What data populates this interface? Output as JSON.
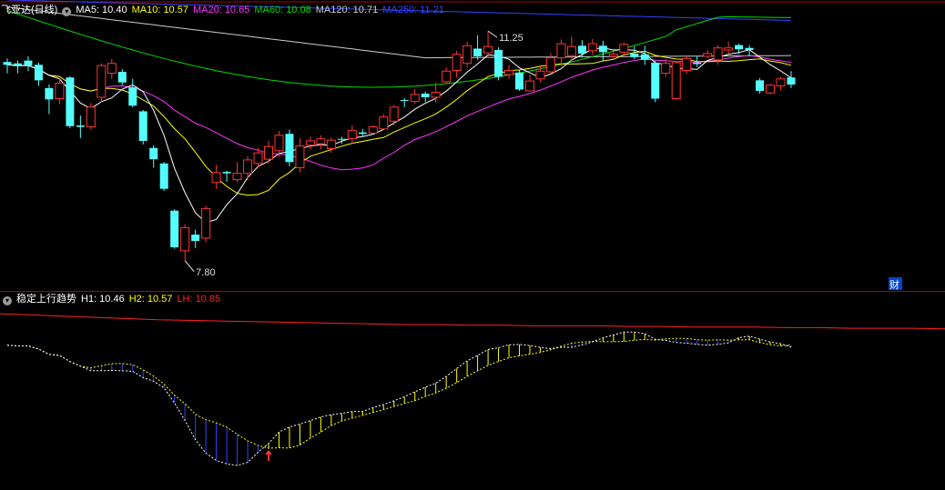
{
  "main_panel": {
    "stock_title": "飞亚达(日线)",
    "indicators": [
      {
        "label": "MA5: 10.40",
        "color": "#ffffff"
      },
      {
        "label": "MA10: 10.57",
        "color": "#ffff00"
      },
      {
        "label": "MA20: 10.65",
        "color": "#ff33ff"
      },
      {
        "label": "MA60: 10.08",
        "color": "#00dd00"
      },
      {
        "label": "MA120: 10.71",
        "color": "#cccccc"
      },
      {
        "label": "MA250: 11.21",
        "color": "#3344ff"
      }
    ],
    "annotations": {
      "high": "11.25",
      "low": "7.80",
      "badge": "财"
    }
  },
  "sub_panel": {
    "title": "稳定上行趋势",
    "indicators": [
      {
        "label": "H1: 10.46",
        "color": "#ffffff"
      },
      {
        "label": "H2: 10.57",
        "color": "#ffff00"
      },
      {
        "label": "LH: 10.85",
        "color": "#ff2222"
      }
    ]
  },
  "colors": {
    "up": "#ff3333",
    "down": "#54ffff",
    "border": "#b00000"
  },
  "chart_data": [
    {
      "type": "candlestick",
      "title": "飞亚达(日线)",
      "ylim": [
        7.5,
        11.5
      ],
      "high_label": 11.25,
      "low_label": 7.8,
      "series": [
        {
          "name": "K",
          "values": [
            {
              "o": 10.62,
              "c": 10.58,
              "h": 10.67,
              "l": 10.46
            },
            {
              "o": 10.6,
              "c": 10.56,
              "h": 10.64,
              "l": 10.46
            },
            {
              "o": 10.64,
              "c": 10.57,
              "h": 10.7,
              "l": 10.49
            },
            {
              "o": 10.58,
              "c": 10.36,
              "h": 10.61,
              "l": 10.28
            },
            {
              "o": 10.25,
              "c": 10.09,
              "h": 10.3,
              "l": 9.88
            },
            {
              "o": 10.1,
              "c": 10.32,
              "h": 10.38,
              "l": 10.02
            },
            {
              "o": 10.4,
              "c": 9.71,
              "h": 10.42,
              "l": 9.68
            },
            {
              "o": 9.72,
              "c": 9.7,
              "h": 9.86,
              "l": 9.54
            },
            {
              "o": 9.7,
              "c": 9.98,
              "h": 10.04,
              "l": 9.66
            },
            {
              "o": 10.12,
              "c": 10.57,
              "h": 10.6,
              "l": 10.05
            },
            {
              "o": 10.46,
              "c": 10.6,
              "h": 10.66,
              "l": 10.38
            },
            {
              "o": 10.48,
              "c": 10.33,
              "h": 10.52,
              "l": 10.29
            },
            {
              "o": 10.26,
              "c": 10.0,
              "h": 10.38,
              "l": 9.98
            },
            {
              "o": 9.92,
              "c": 9.5,
              "h": 9.94,
              "l": 9.45
            },
            {
              "o": 9.4,
              "c": 9.24,
              "h": 9.44,
              "l": 9.12
            },
            {
              "o": 9.18,
              "c": 8.82,
              "h": 9.2,
              "l": 8.79
            },
            {
              "o": 8.51,
              "c": 7.99,
              "h": 8.53,
              "l": 7.97
            },
            {
              "o": 7.94,
              "c": 8.27,
              "h": 8.32,
              "l": 7.8
            },
            {
              "o": 8.17,
              "c": 8.08,
              "h": 8.24,
              "l": 7.98
            },
            {
              "o": 8.12,
              "c": 8.54,
              "h": 8.58,
              "l": 8.06
            },
            {
              "o": 8.91,
              "c": 9.05,
              "h": 9.16,
              "l": 8.82
            },
            {
              "o": 9.06,
              "c": 9.04,
              "h": 9.08,
              "l": 8.92
            },
            {
              "o": 8.95,
              "c": 9.04,
              "h": 9.2,
              "l": 8.91
            },
            {
              "o": 9.04,
              "c": 9.23,
              "h": 9.28,
              "l": 8.94
            },
            {
              "o": 9.18,
              "c": 9.33,
              "h": 9.4,
              "l": 9.12
            },
            {
              "o": 9.24,
              "c": 9.42,
              "h": 9.5,
              "l": 9.18
            },
            {
              "o": 9.36,
              "c": 9.58,
              "h": 9.64,
              "l": 9.27
            },
            {
              "o": 9.6,
              "c": 9.2,
              "h": 9.66,
              "l": 9.14
            },
            {
              "o": 9.12,
              "c": 9.43,
              "h": 9.54,
              "l": 9.05
            },
            {
              "o": 9.44,
              "c": 9.5,
              "h": 9.56,
              "l": 9.38
            },
            {
              "o": 9.46,
              "c": 9.53,
              "h": 9.58,
              "l": 9.38
            },
            {
              "o": 9.39,
              "c": 9.51,
              "h": 9.55,
              "l": 9.33
            },
            {
              "o": 9.53,
              "c": 9.52,
              "h": 9.56,
              "l": 9.46
            },
            {
              "o": 9.53,
              "c": 9.65,
              "h": 9.72,
              "l": 9.46
            },
            {
              "o": 9.62,
              "c": 9.6,
              "h": 9.67,
              "l": 9.56
            },
            {
              "o": 9.61,
              "c": 9.7,
              "h": 9.72,
              "l": 9.6
            },
            {
              "o": 9.67,
              "c": 9.84,
              "h": 9.88,
              "l": 9.66
            },
            {
              "o": 9.78,
              "c": 9.98,
              "h": 10.01,
              "l": 9.72
            },
            {
              "o": 10.08,
              "c": 10.07,
              "h": 10.11,
              "l": 9.98
            },
            {
              "o": 10.06,
              "c": 10.16,
              "h": 10.24,
              "l": 10.03
            },
            {
              "o": 10.17,
              "c": 10.12,
              "h": 10.2,
              "l": 10.05
            },
            {
              "o": 10.12,
              "c": 10.19,
              "h": 10.33,
              "l": 10.05
            },
            {
              "o": 10.34,
              "c": 10.49,
              "h": 10.54,
              "l": 10.32
            },
            {
              "o": 10.5,
              "c": 10.73,
              "h": 10.78,
              "l": 10.4
            },
            {
              "o": 10.6,
              "c": 10.85,
              "h": 10.91,
              "l": 10.55
            },
            {
              "o": 10.81,
              "c": 10.7,
              "h": 11.0,
              "l": 10.65
            },
            {
              "o": 10.75,
              "c": 10.84,
              "h": 11.06,
              "l": 10.7
            },
            {
              "o": 10.79,
              "c": 10.41,
              "h": 10.83,
              "l": 10.36
            },
            {
              "o": 10.44,
              "c": 10.5,
              "h": 10.58,
              "l": 10.38
            },
            {
              "o": 10.47,
              "c": 10.23,
              "h": 10.5,
              "l": 10.21
            },
            {
              "o": 10.21,
              "c": 10.35,
              "h": 10.44,
              "l": 10.2
            },
            {
              "o": 10.38,
              "c": 10.49,
              "h": 10.56,
              "l": 10.33
            },
            {
              "o": 10.48,
              "c": 10.68,
              "h": 10.75,
              "l": 10.46
            },
            {
              "o": 10.68,
              "c": 10.88,
              "h": 10.94,
              "l": 10.56
            },
            {
              "o": 10.71,
              "c": 10.84,
              "h": 10.98,
              "l": 10.64
            },
            {
              "o": 10.85,
              "c": 10.74,
              "h": 10.93,
              "l": 10.7
            },
            {
              "o": 10.78,
              "c": 10.88,
              "h": 10.95,
              "l": 10.72
            },
            {
              "o": 10.85,
              "c": 10.76,
              "h": 10.92,
              "l": 10.64
            },
            {
              "o": 10.7,
              "c": 10.73,
              "h": 10.78,
              "l": 10.66
            },
            {
              "o": 10.76,
              "c": 10.87,
              "h": 10.9,
              "l": 10.7
            },
            {
              "o": 10.74,
              "c": 10.69,
              "h": 10.84,
              "l": 10.66
            },
            {
              "o": 10.73,
              "c": 10.65,
              "h": 10.85,
              "l": 10.58
            },
            {
              "o": 10.61,
              "c": 10.1,
              "h": 10.64,
              "l": 10.05
            },
            {
              "o": 10.46,
              "c": 10.6,
              "h": 10.66,
              "l": 10.41
            },
            {
              "o": 10.1,
              "c": 10.61,
              "h": 10.63,
              "l": 10.08
            },
            {
              "o": 10.5,
              "c": 10.67,
              "h": 10.71,
              "l": 10.45
            },
            {
              "o": 10.61,
              "c": 10.59,
              "h": 10.7,
              "l": 10.55
            },
            {
              "o": 10.7,
              "c": 10.74,
              "h": 10.79,
              "l": 10.67
            },
            {
              "o": 10.65,
              "c": 10.82,
              "h": 10.86,
              "l": 10.58
            },
            {
              "o": 10.79,
              "c": 10.82,
              "h": 10.91,
              "l": 10.74
            },
            {
              "o": 10.86,
              "c": 10.8,
              "h": 10.88,
              "l": 10.73
            },
            {
              "o": 10.82,
              "c": 10.79,
              "h": 10.86,
              "l": 10.7
            },
            {
              "o": 10.36,
              "c": 10.21,
              "h": 10.39,
              "l": 10.17
            },
            {
              "o": 10.18,
              "c": 10.29,
              "h": 10.31,
              "l": 10.16
            },
            {
              "o": 10.28,
              "c": 10.38,
              "h": 10.41,
              "l": 10.22
            },
            {
              "o": 10.4,
              "c": 10.3,
              "h": 10.49,
              "l": 10.25
            }
          ]
        },
        {
          "name": "MA5",
          "color": "#ffffff"
        },
        {
          "name": "MA10",
          "color": "#ffff00"
        },
        {
          "name": "MA20",
          "color": "#ff33ff"
        },
        {
          "name": "MA60",
          "color": "#00dd00"
        },
        {
          "name": "MA120",
          "color": "#cccccc"
        },
        {
          "name": "MA250",
          "color": "#3344ff"
        }
      ]
    },
    {
      "type": "line",
      "title": "稳定上行趋势",
      "ylim": [
        8.2,
        11.4
      ],
      "series": [
        {
          "name": "H1",
          "color": "#ffffff"
        },
        {
          "name": "H2",
          "color": "#ffff00"
        },
        {
          "name": "LH",
          "color": "#ff2222",
          "values": [
            11.1,
            11.08,
            11.06,
            11.04,
            11.02,
            11.0,
            10.99,
            10.98,
            10.97,
            10.96,
            10.95,
            10.94,
            10.93,
            10.92,
            10.92,
            10.91,
            10.91,
            10.9,
            10.9,
            10.9,
            10.89,
            10.89,
            10.88,
            10.88,
            10.88,
            10.87,
            10.87,
            10.86,
            10.86,
            10.86,
            10.85
          ]
        }
      ]
    }
  ]
}
